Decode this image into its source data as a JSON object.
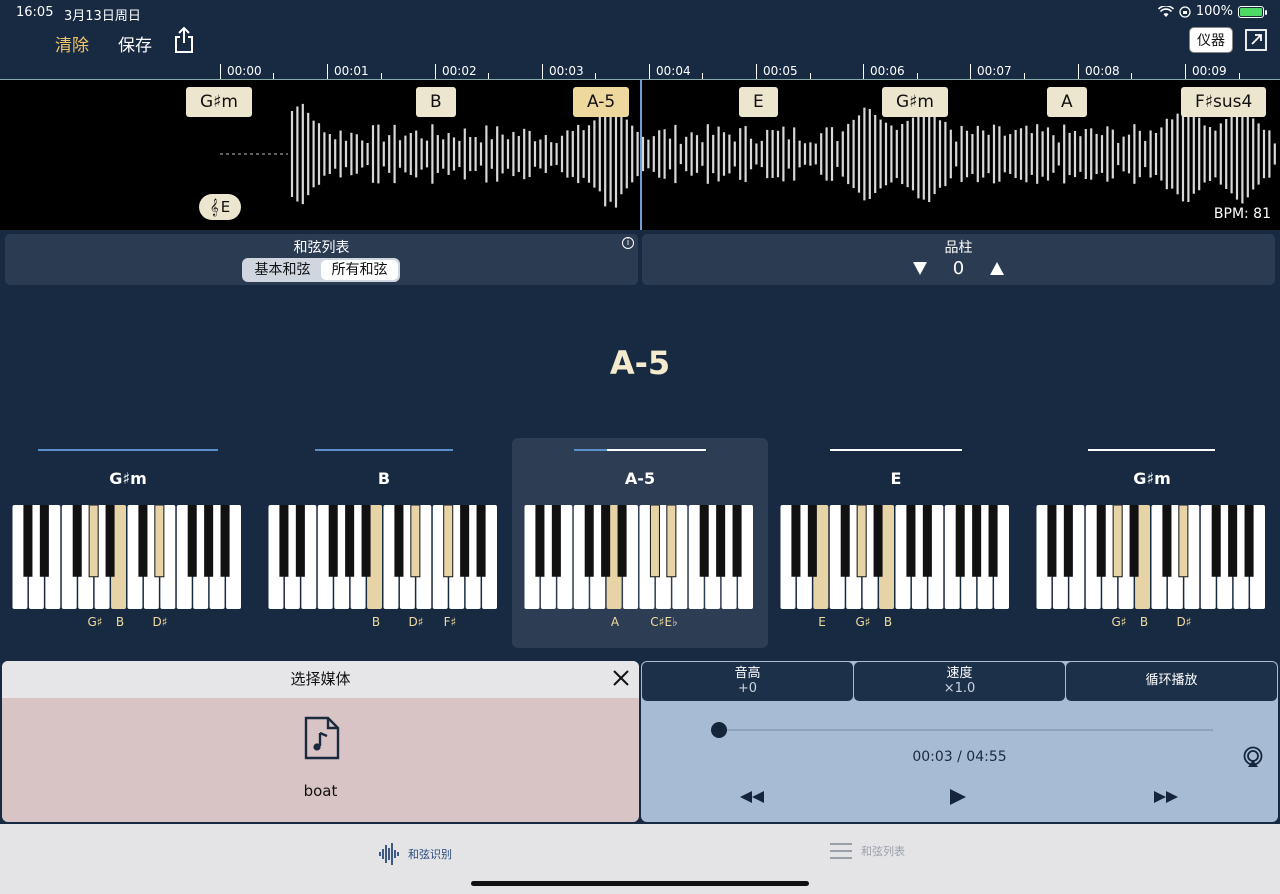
{
  "status": {
    "time": "16:05",
    "date": "3月13日周日",
    "battery": "100%"
  },
  "toolbar": {
    "clear": "清除",
    "save": "保存",
    "instrument": "仪器"
  },
  "timeline": [
    "00:00",
    "00:01",
    "00:02",
    "00:03",
    "00:04",
    "00:05",
    "00:06",
    "00:07",
    "00:08",
    "00:09"
  ],
  "waveform": {
    "chords": [
      "G♯m",
      "B",
      "A-5",
      "E",
      "G♯m",
      "A",
      "F♯sus4"
    ],
    "active_chord": "A-5",
    "key": "E",
    "bpm": "BPM: 81"
  },
  "chord_list_panel": {
    "title": "和弦列表",
    "seg_basic": "基本和弦",
    "seg_all": "所有和弦"
  },
  "capo_panel": {
    "title": "品柱",
    "value": "0"
  },
  "current_chord": "A-5",
  "cards": [
    {
      "name": "G♯m",
      "notes": [
        "G♯",
        "B",
        "D♯"
      ]
    },
    {
      "name": "B",
      "notes": [
        "B",
        "D♯",
        "F♯"
      ]
    },
    {
      "name": "A-5",
      "notes": [
        "A",
        "C♯E♭"
      ]
    },
    {
      "name": "E",
      "notes": [
        "E",
        "G♯",
        "B"
      ]
    },
    {
      "name": "G♯m",
      "notes": [
        "G♯",
        "B",
        "D♯"
      ]
    }
  ],
  "media": {
    "title": "选择媒体",
    "file": "boat"
  },
  "player": {
    "pitch_label": "音高",
    "pitch_value": "+0",
    "speed_label": "速度",
    "speed_value": "×1.0",
    "loop_label": "循环播放",
    "time": "00:03 / 04:55",
    "progress": 0.011
  },
  "tabs": {
    "recognize": "和弦识别",
    "list": "和弦列表"
  }
}
